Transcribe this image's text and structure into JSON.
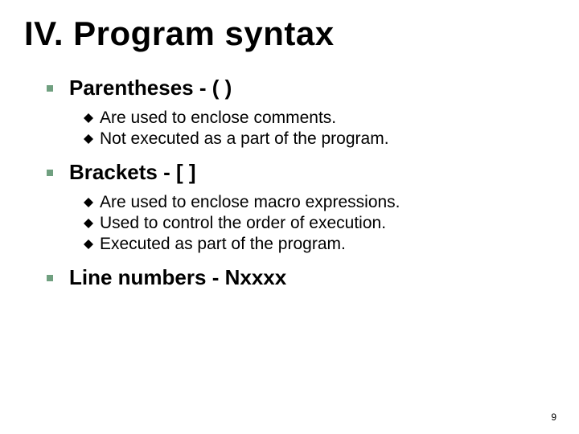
{
  "slide": {
    "title": "IV. Program syntax",
    "sections": [
      {
        "heading": "Parentheses - ( )",
        "items": [
          "Are used to enclose comments.",
          "Not executed as a part of the program."
        ]
      },
      {
        "heading": "Brackets - [ ]",
        "items": [
          "Are used to enclose macro expressions.",
          "Used to control the order of execution.",
          "Executed as part of the program."
        ]
      },
      {
        "heading": "Line numbers - Nxxxx",
        "items": []
      }
    ],
    "pageNumber": "9"
  },
  "colors": {
    "squareBullet": "#70a080",
    "diamondBullet": "#000"
  }
}
